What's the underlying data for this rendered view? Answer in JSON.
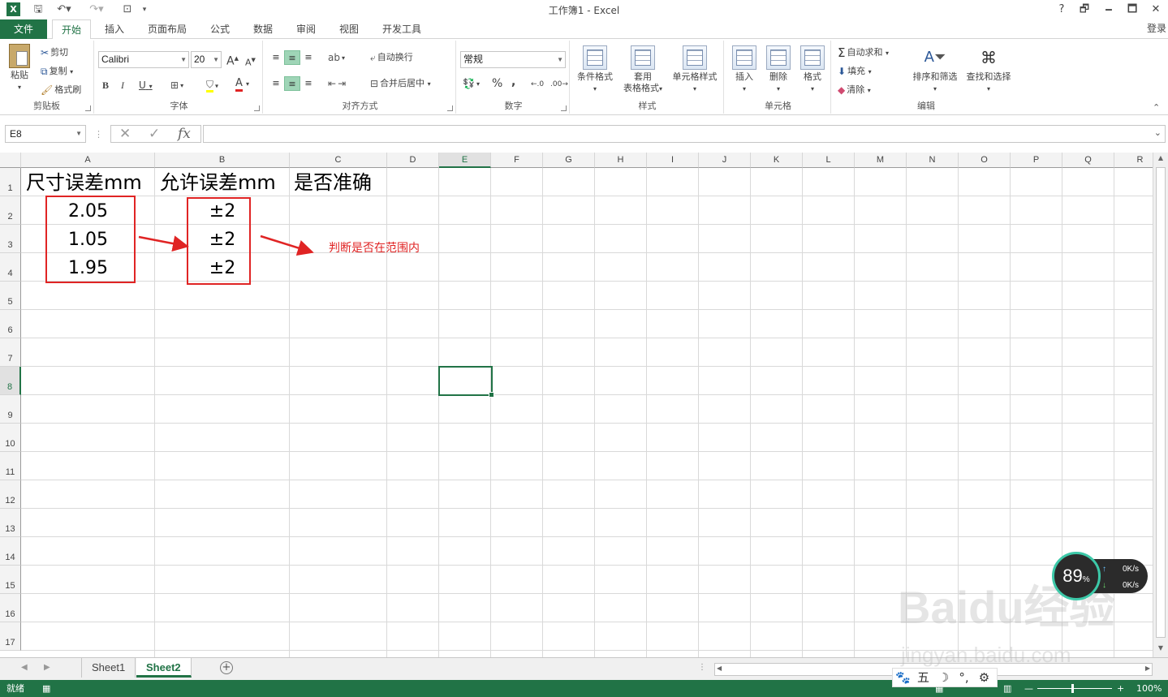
{
  "app": {
    "title": "工作簿1 - Excel",
    "login_label": "登录"
  },
  "quick_access": {
    "save_icon": "save-icon",
    "undo_icon": "undo-icon",
    "redo_icon": "redo-icon"
  },
  "window": {
    "help": "?",
    "restore": "🗗",
    "minimize": "🗕",
    "maximize": "🗖",
    "close": "✕"
  },
  "ribbon_tabs": [
    {
      "label": "文件"
    },
    {
      "label": "开始"
    },
    {
      "label": "插入"
    },
    {
      "label": "页面布局"
    },
    {
      "label": "公式"
    },
    {
      "label": "数据"
    },
    {
      "label": "审阅"
    },
    {
      "label": "视图"
    },
    {
      "label": "开发工具"
    }
  ],
  "clipboard": {
    "paste": "粘贴",
    "cut": "剪切",
    "copy": "复制",
    "format_painter": "格式刷",
    "group": "剪贴板"
  },
  "font": {
    "name": "Calibri",
    "size": "20",
    "bold": "B",
    "italic": "I",
    "underline": "U",
    "grow": "A",
    "shrink": "A",
    "color_letter": "A",
    "group": "字体"
  },
  "alignment": {
    "wrap_text": "自动换行",
    "merge_center": "合并后居中",
    "group": "对齐方式"
  },
  "number": {
    "format": "常规",
    "percent": "%",
    "comma": ",",
    "group": "数字"
  },
  "styles": {
    "conditional": "条件格式",
    "table_line1": "套用",
    "table_line2": "表格格式",
    "cell_styles": "单元格样式",
    "group": "样式"
  },
  "cells": {
    "insert": "插入",
    "delete": "删除",
    "format": "格式",
    "group": "单元格"
  },
  "editing": {
    "autosum": "自动求和",
    "fill": "填充",
    "clear": "清除",
    "sort_filter": "排序和筛选",
    "find_select": "查找和选择",
    "group": "编辑"
  },
  "formula_bar": {
    "name_box": "E8",
    "fx": "fx",
    "formula": ""
  },
  "columns": [
    "A",
    "B",
    "C",
    "D",
    "E",
    "F",
    "G",
    "H",
    "I",
    "J",
    "K",
    "L",
    "M",
    "N",
    "O",
    "P",
    "Q",
    "R"
  ],
  "rows": [
    "1",
    "2",
    "3",
    "4",
    "5",
    "6",
    "7",
    "8",
    "9",
    "10",
    "11",
    "12",
    "13",
    "14",
    "15",
    "16",
    "17"
  ],
  "cells_data": {
    "a1": "尺寸误差mm",
    "b1": "允许误差mm",
    "c1": "是否准确",
    "a2": "2.05",
    "a3": "1.05",
    "a4": "1.95",
    "b2": "±2",
    "b3": "±2",
    "b4": "±2"
  },
  "annotation": {
    "text": "判断是否在范围内",
    "color": "#e02424"
  },
  "sheets": [
    {
      "label": "Sheet1"
    },
    {
      "label": "Sheet2",
      "active": true
    }
  ],
  "status": {
    "ready": "就绪",
    "zoom": "100%"
  },
  "speed_widget": {
    "percent": "89",
    "unit": "%",
    "up": "0K/s",
    "down": "0K/s"
  },
  "ime": {
    "mode": "五"
  },
  "watermark": {
    "line1": "Baidu经验",
    "line2": "jingyan.baidu.com"
  },
  "colors": {
    "excel_green": "#217346",
    "annotation_red": "#e02424"
  }
}
